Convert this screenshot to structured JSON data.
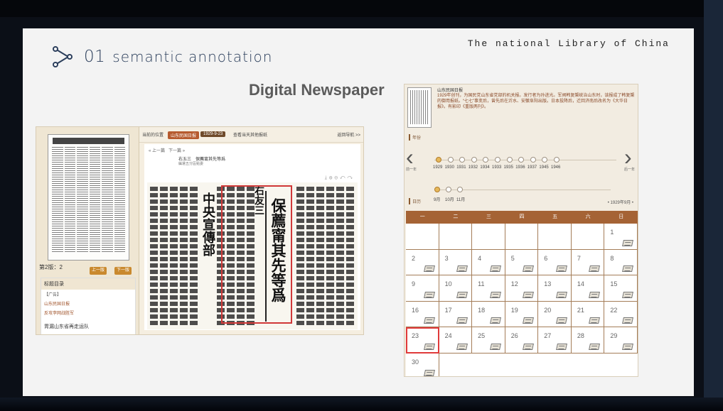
{
  "header": {
    "brand": "The national Library of China",
    "section_number": "01",
    "section_title": "semantic annotation",
    "main_title": "Digital Newspaper"
  },
  "left_screenshot": {
    "breadcrumb_location": "当前的位置",
    "breadcrumb_paper": "山东民国日报",
    "breadcrumb_date": "1929-9-23",
    "breadcrumb_view": "查看当天其他报纸",
    "back_link": "返回导航 >>",
    "nav_prev": "« 上一篇",
    "nav_next": "下一篇 »",
    "article_title": "右五三　保薦甯其先等爲",
    "article_subtitle": "編遣五分區點委",
    "page_label": "第2版：2",
    "prev_page": "上一版",
    "next_page": "下一版",
    "toc_title": "标题目录",
    "toc_items": [
      "【广告】",
      "山东民国日报",
      "反攻李网战胜军",
      "胃漏山东省再走运队"
    ],
    "scan_headline": "保薦甯其先等爲",
    "scan_side_text": "中央宣傳部",
    "scan_top_text": "右友三"
  },
  "right_screenshot": {
    "paper_name": "山东民国日报",
    "description": "1929年创刊，为国民党山东省党部的机关报。发行者为孙进光。军阀韩复榘统治山东时，该报成了韩复榘的御用报纸。“七七”事变后，曾先后在沂水、安徽阜阳出版。日本投降后，迁回济南后改名为《大华日报》。有影印《重版两刊》。",
    "year_label": "年份",
    "prev_label": "前一年",
    "next_label": "后一年",
    "years": [
      "1929",
      "1930",
      "1931",
      "1932",
      "1934",
      "1933",
      "1935",
      "1936",
      "1937",
      "1945",
      "1946"
    ],
    "month_label": "日历",
    "months": [
      "9月",
      "10月",
      "11月"
    ],
    "current_month": "• 1929年9月 •",
    "weekdays": [
      "一",
      "二",
      "三",
      "四",
      "五",
      "六",
      "日"
    ],
    "days": [
      "",
      "",
      "",
      "",
      "",
      "",
      "1",
      "2",
      "3",
      "4",
      "5",
      "6",
      "7",
      "8",
      "9",
      "10",
      "11",
      "12",
      "13",
      "14",
      "15",
      "16",
      "17",
      "18",
      "19",
      "20",
      "21",
      "22",
      "23",
      "24",
      "25",
      "26",
      "27",
      "28",
      "29",
      "30"
    ],
    "highlighted_day": "23"
  }
}
